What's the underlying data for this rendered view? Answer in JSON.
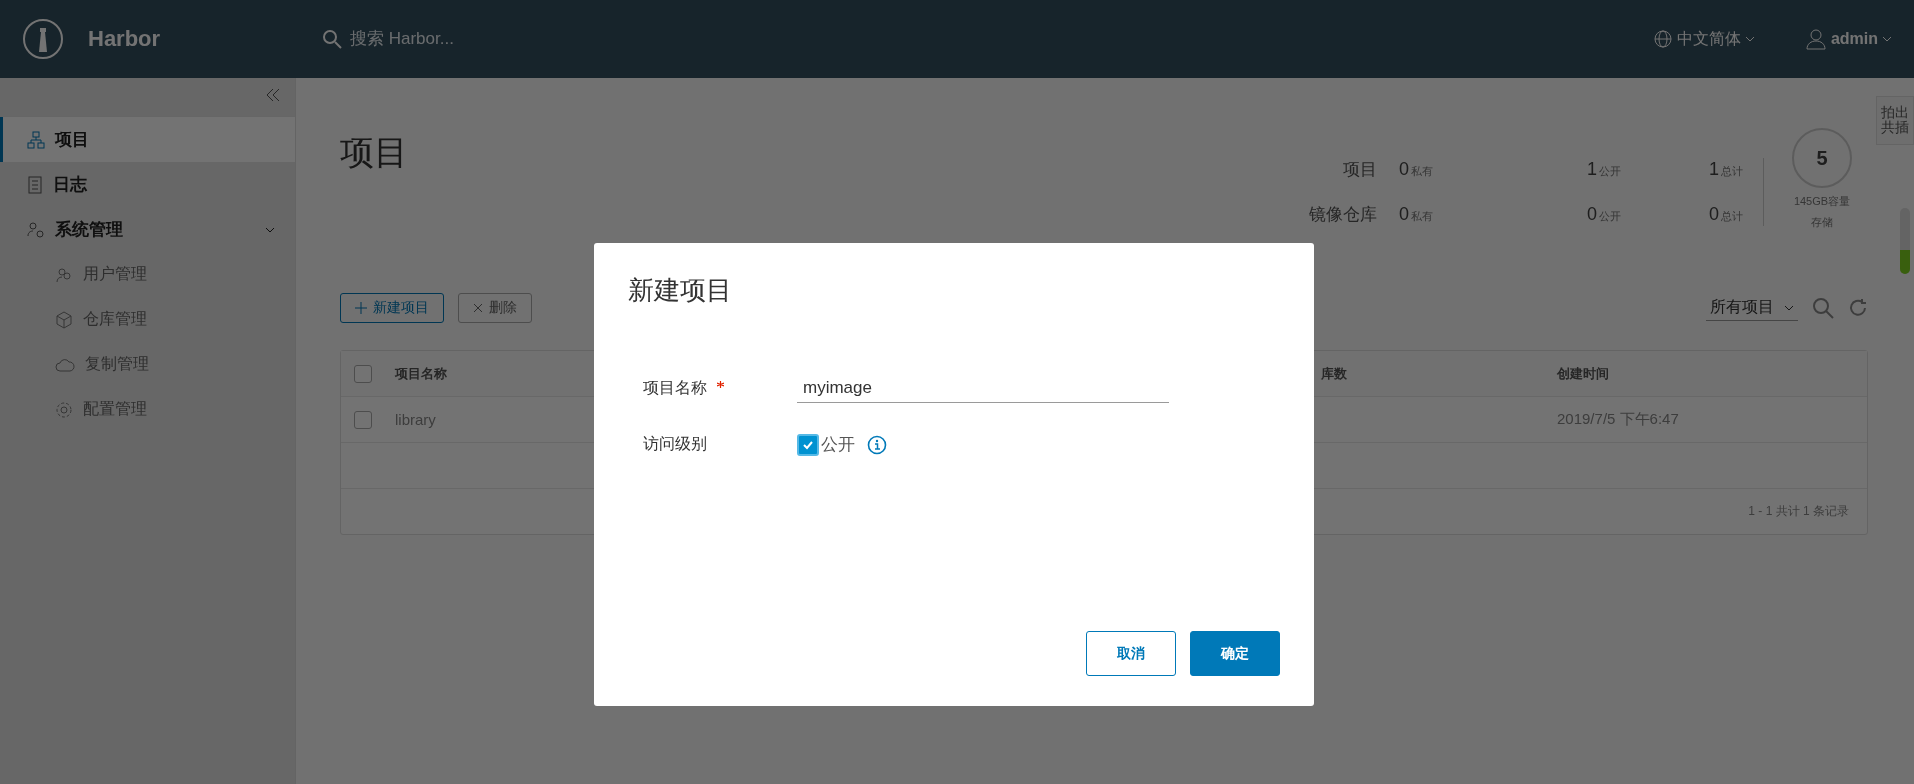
{
  "header": {
    "brand": "Harbor",
    "search": {
      "placeholder": "搜索 Harbor..."
    },
    "language": "中文简体",
    "user": "admin"
  },
  "sidebar": {
    "items": [
      {
        "label": "项目",
        "selected": true
      },
      {
        "label": "日志",
        "selected": false
      },
      {
        "label": "系统管理",
        "selected": false,
        "expanded": true,
        "children": [
          {
            "label": "用户管理",
            "selected": false
          },
          {
            "label": "仓库管理",
            "selected": false
          },
          {
            "label": "复制管理",
            "selected": false
          },
          {
            "label": "配置管理",
            "selected": false
          }
        ]
      }
    ]
  },
  "page_title": "项目",
  "stats": {
    "rows": [
      {
        "label": "项目",
        "values": [
          {
            "count": "0",
            "label": "私有"
          },
          {
            "count": "1",
            "label": "公开"
          },
          {
            "count": "1",
            "label": "总计"
          }
        ]
      },
      {
        "label": "镜像仓库",
        "values": [
          {
            "count": "0",
            "label": "私有"
          },
          {
            "count": "0",
            "label": "公开"
          },
          {
            "count": "0",
            "label": "总计"
          }
        ]
      }
    ],
    "storage": {
      "count": "5",
      "capacity": "145GB容量",
      "label": "存储"
    }
  },
  "side_tab": "拍出共插",
  "toolbar": {
    "buttons": [
      {
        "label": "新建项目",
        "disabled": false
      },
      {
        "label": "删除",
        "disabled": true
      }
    ],
    "filter": "所有项目"
  },
  "table": {
    "header_checked": false,
    "columns": [
      "项目名称",
      "库数",
      "创建时间"
    ],
    "rows": [
      {
        "checked": false,
        "cells": [
          "library",
          "",
          "2019/7/5 下午6:47"
        ]
      }
    ],
    "footer": "1 - 1 共计 1 条记录"
  },
  "dialog": {
    "title": "新建项目",
    "fields": [
      {
        "kind": "text",
        "label": "项目名称",
        "required": true,
        "value": "myimage"
      },
      {
        "kind": "checkbox",
        "label": "访问级别",
        "option": "公开",
        "checked": true
      }
    ],
    "buttons": [
      {
        "label": "取消",
        "kind": "secondary"
      },
      {
        "label": "确定",
        "kind": "primary"
      }
    ]
  }
}
